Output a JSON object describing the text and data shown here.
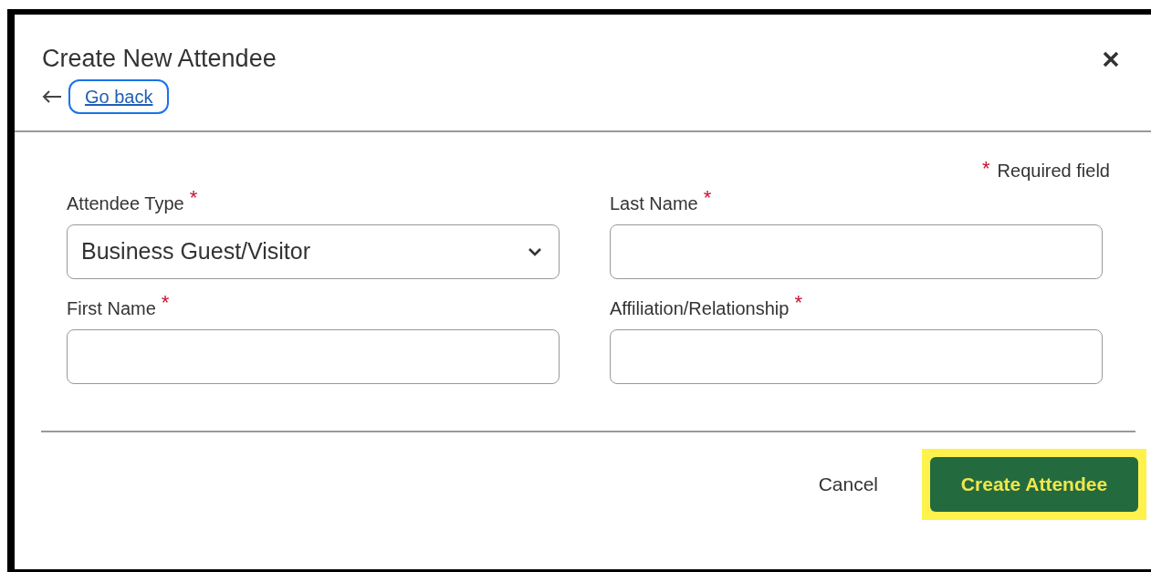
{
  "dialog": {
    "title": "Create New Attendee",
    "back_link": "Go back",
    "back_link_focused": true
  },
  "required_legend": {
    "mark": "*",
    "text": "Required field"
  },
  "fields": [
    {
      "kind": "select",
      "label": "Attendee Type",
      "required_mark": "*",
      "value": "Business Guest/Visitor"
    },
    {
      "kind": "text",
      "label": "Last Name",
      "required_mark": "*"
    },
    {
      "kind": "text",
      "label": "First Name",
      "required_mark": "*"
    },
    {
      "kind": "text",
      "label": "Affiliation/Relationship",
      "required_mark": "*"
    }
  ],
  "buttons": [
    {
      "kind": "secondary",
      "label": "Cancel",
      "highlighted": false
    },
    {
      "kind": "primary",
      "label": "Create Attendee",
      "highlighted": true
    }
  ]
}
